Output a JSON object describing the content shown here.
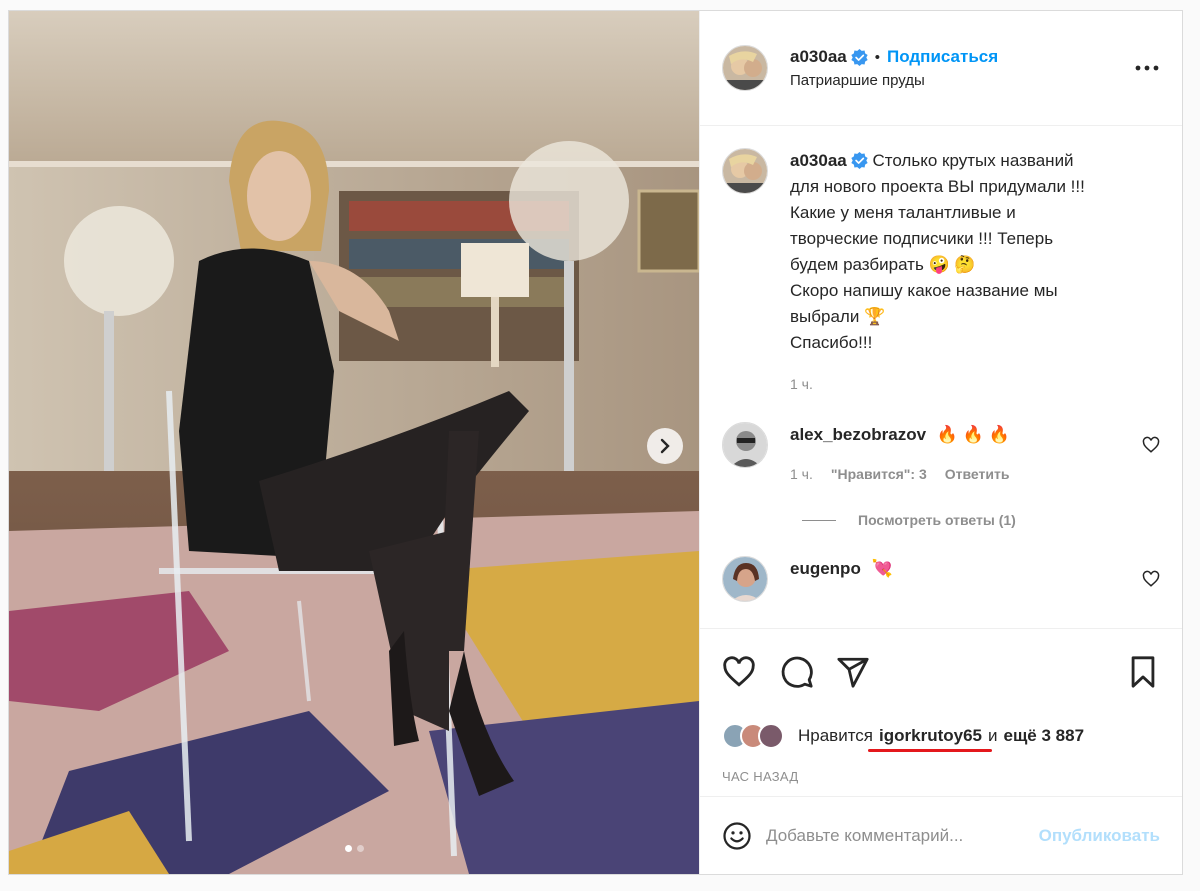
{
  "post": {
    "author": "a030aa",
    "follow_label": "Подписаться",
    "separator": "•",
    "location": "Патриаршие пруды",
    "caption_lines": [
      "Столько крутых названий",
      "для нового проекта ВЫ придумали !!!",
      "Какие у меня талантливые и",
      "творческие подписчики !!! Теперь",
      "будем разбирать 🤪 🤔",
      "Скоро напишу какое название мы",
      "выбрали 🏆",
      "Спасибо!!!"
    ],
    "caption_time": "1 ч.",
    "carousel_position": 1,
    "carousel_total": 2
  },
  "comments": [
    {
      "user": "alex_bezobrazov",
      "text": "🔥 🔥 🔥",
      "time": "1 ч.",
      "likes_label": "\"Нравится\": 3",
      "reply_label": "Ответить",
      "view_replies": "Посмотреть ответы (1)"
    },
    {
      "user": "eugenpo",
      "text": "💘"
    }
  ],
  "likes": {
    "prefix": "Нравится",
    "user": "igorkrutoy65",
    "and_label": "и",
    "rest": "ещё 3 887"
  },
  "time_label": "ЧАС НАЗАД",
  "add_comment": {
    "placeholder": "Добавьте комментарий...",
    "publish_label": "Опубликовать"
  },
  "colors": {
    "accent": "#0095f6",
    "publish_disabled": "#b2dffc",
    "verified": "#3897f0",
    "annotation_underline": "#e4181c"
  },
  "icons": [
    "verified-badge-icon",
    "more-icon",
    "heart-icon",
    "comment-icon",
    "share-icon",
    "bookmark-icon",
    "emoji-icon",
    "chevron-right-icon"
  ]
}
